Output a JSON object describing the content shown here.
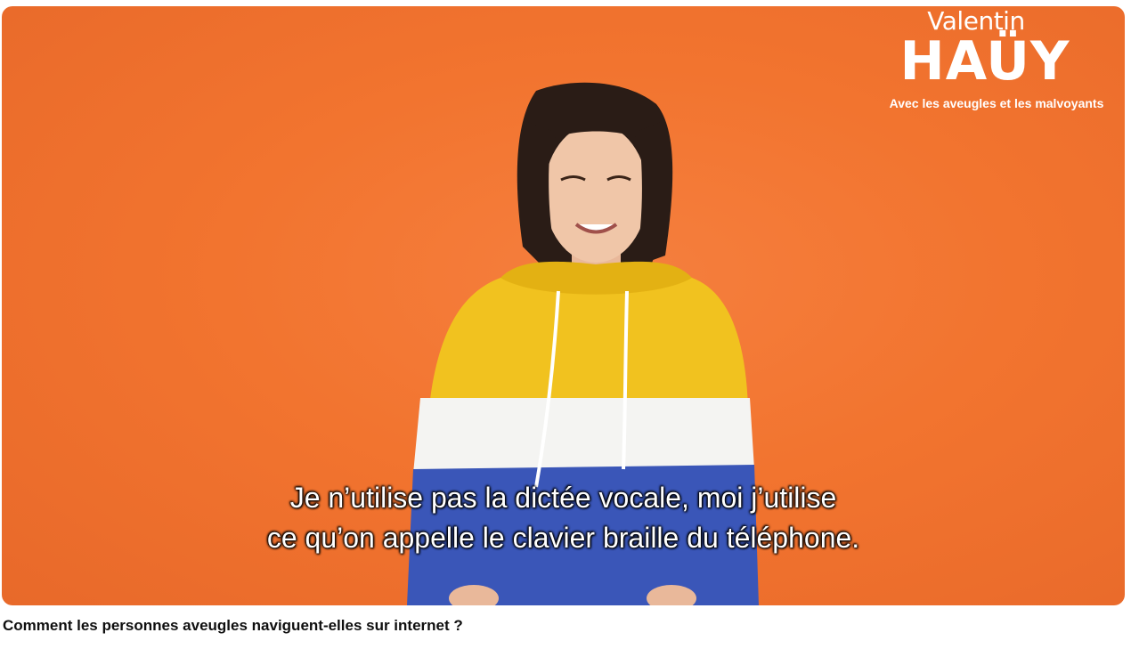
{
  "video": {
    "logo": {
      "line1": "Valentin",
      "line2": "HAÜY",
      "tagline": "Avec les aveugles et les malvoyants"
    },
    "subtitles": [
      "Je n’utilise pas la dictée vocale, moi j’utilise",
      "ce qu’on appelle le clavier braille du téléphone."
    ],
    "background_color": "#f2742f"
  },
  "title": "Comment les personnes aveugles naviguent-elles sur internet ?"
}
